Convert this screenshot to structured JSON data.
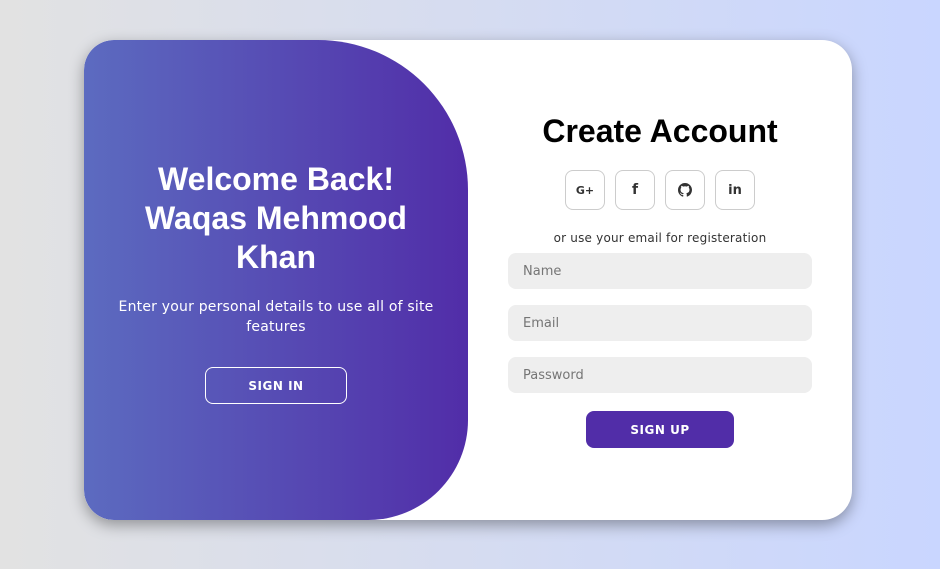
{
  "toggle": {
    "title": "Welcome Back!\nWaqas Mehmood\nKhan",
    "subtitle": "Enter your personal details to use all of site features",
    "sign_in_label": "SIGN IN"
  },
  "form": {
    "title": "Create Account",
    "social": [
      {
        "icon": "google-plus-icon",
        "label": "G+"
      },
      {
        "icon": "facebook-icon",
        "label": "f"
      },
      {
        "icon": "github-icon",
        "label": ""
      },
      {
        "icon": "linkedin-icon",
        "label": "in"
      }
    ],
    "hint": "or use your email for registeration",
    "name_placeholder": "Name",
    "email_placeholder": "Email",
    "password_placeholder": "Password",
    "sign_up_label": "SIGN UP"
  },
  "colors": {
    "accent": "#512da8",
    "panel_gradient_start": "#5c6bc0",
    "input_bg": "#eeeeee",
    "page_bg_start": "#e2e2e2",
    "page_bg_end": "#c9d6ff"
  }
}
